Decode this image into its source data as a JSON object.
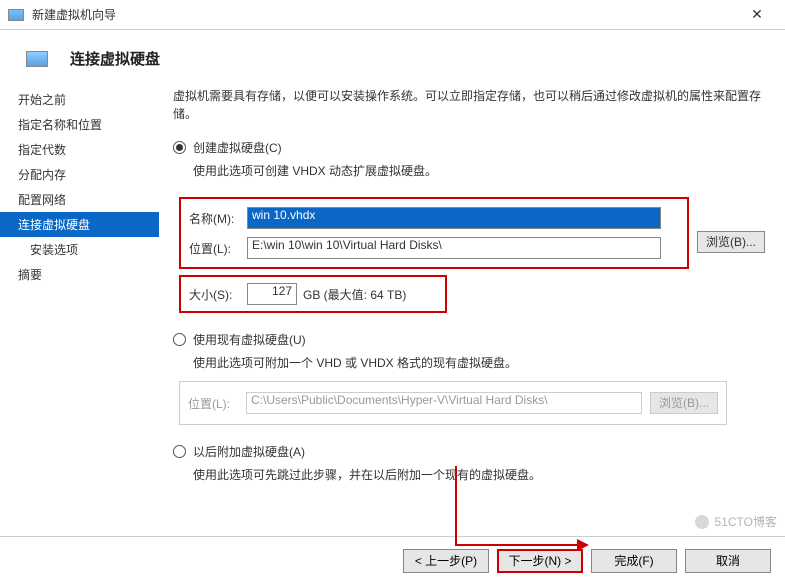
{
  "window": {
    "title": "新建虚拟机向导"
  },
  "header": {
    "title": "连接虚拟硬盘"
  },
  "sidebar": {
    "items": [
      {
        "label": "开始之前"
      },
      {
        "label": "指定名称和位置"
      },
      {
        "label": "指定代数"
      },
      {
        "label": "分配内存"
      },
      {
        "label": "配置网络"
      },
      {
        "label": "连接虚拟硬盘"
      },
      {
        "label": "安装选项"
      },
      {
        "label": "摘要"
      }
    ]
  },
  "main": {
    "desc": "虚拟机需要具有存储，以便可以安装操作系统。可以立即指定存储，也可以稍后通过修改虚拟机的属性来配置存储。",
    "opt1": {
      "label": "创建虚拟硬盘(C)",
      "sub": "使用此选项可创建 VHDX 动态扩展虚拟硬盘。",
      "name_label": "名称(M):",
      "name_value": "win  10.vhdx",
      "loc_label": "位置(L):",
      "loc_value": "E:\\win 10\\win  10\\Virtual Hard Disks\\",
      "browse": "浏览(B)...",
      "size_label": "大小(S):",
      "size_value": "127",
      "size_unit": "GB (最大值: 64 TB)"
    },
    "opt2": {
      "label": "使用现有虚拟硬盘(U)",
      "sub": "使用此选项可附加一个 VHD 或 VHDX 格式的现有虚拟硬盘。",
      "loc_label": "位置(L):",
      "loc_value": "C:\\Users\\Public\\Documents\\Hyper-V\\Virtual Hard Disks\\",
      "browse": "浏览(B)..."
    },
    "opt3": {
      "label": "以后附加虚拟硬盘(A)",
      "sub": "使用此选项可先跳过此步骤，并在以后附加一个现有的虚拟硬盘。"
    }
  },
  "footer": {
    "prev": "< 上一步(P)",
    "next": "下一步(N) >",
    "finish": "完成(F)",
    "cancel": "取消"
  },
  "watermark": "51CTO博客"
}
